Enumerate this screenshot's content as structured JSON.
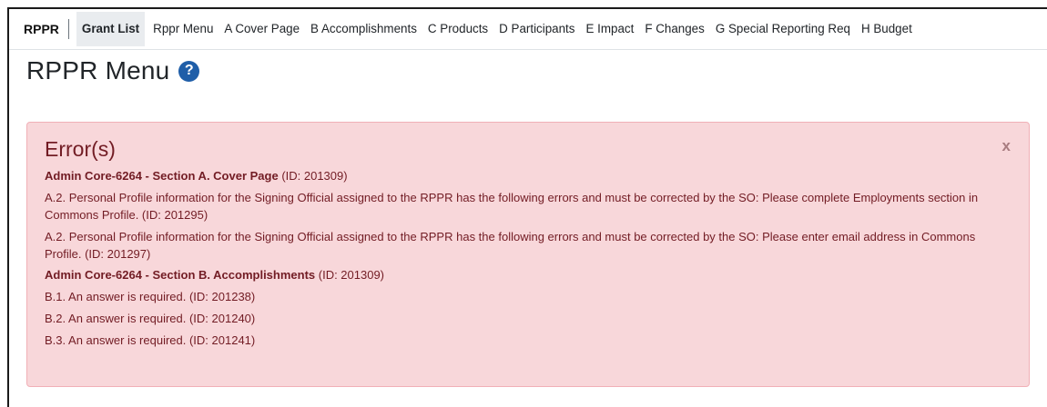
{
  "nav": {
    "brand": "RPPR",
    "items": [
      {
        "label": "Grant List",
        "active": true
      },
      {
        "label": "Rppr Menu"
      },
      {
        "label": "A Cover Page"
      },
      {
        "label": "B Accomplishments"
      },
      {
        "label": "C Products"
      },
      {
        "label": "D Participants"
      },
      {
        "label": "E Impact"
      },
      {
        "label": "F Changes"
      },
      {
        "label": "G Special Reporting Req"
      },
      {
        "label": "H Budget"
      }
    ]
  },
  "page": {
    "title": "RPPR Menu",
    "help_icon_glyph": "?"
  },
  "errors": {
    "title": "Error(s)",
    "close_label": "x",
    "sections": [
      {
        "heading": "Admin Core-6264 - Section A. Cover Page",
        "heading_id": " (ID: 201309)",
        "items": [
          "A.2. Personal Profile information for the Signing Official assigned to the RPPR has the following errors and must be corrected by the SO: Please complete Employments section in Commons Profile. (ID: 201295)",
          "A.2. Personal Profile information for the Signing Official assigned to the RPPR has the following errors and must be corrected by the SO: Please enter email address in Commons Profile. (ID: 201297)"
        ]
      },
      {
        "heading": "Admin Core-6264 - Section B. Accomplishments",
        "heading_id": " (ID: 201309)",
        "items": [
          "B.1. An answer is required. (ID: 201238)",
          "B.2. An answer is required. (ID: 201240)",
          "B.3. An answer is required. (ID: 201241)"
        ]
      }
    ]
  },
  "colors": {
    "alert_bg": "#f8d7da",
    "alert_text": "#721c24",
    "help_icon": "#1f5ea8",
    "active_tab_bg": "#e9ecef"
  }
}
